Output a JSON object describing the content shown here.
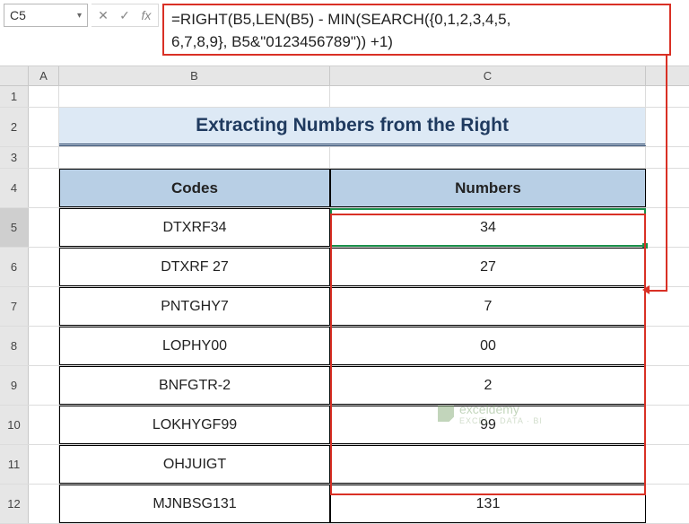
{
  "nameBox": {
    "value": "C5"
  },
  "formulaBar": {
    "line1": "=RIGHT(B5,LEN(B5) - MIN(SEARCH({0,1,2,3,4,5,",
    "line2": "6,7,8,9}, B5&\"0123456789\")) +1)"
  },
  "columns": {
    "A": "A",
    "B": "B",
    "C": "C"
  },
  "rowLabels": [
    "1",
    "2",
    "3",
    "4",
    "5",
    "6",
    "7",
    "8",
    "9",
    "10",
    "11",
    "12"
  ],
  "title": "Extracting Numbers from the Right",
  "headers": {
    "codes": "Codes",
    "numbers": "Numbers"
  },
  "table": [
    {
      "code": "DTXRF34",
      "num": "34"
    },
    {
      "code": "DTXRF 27",
      "num": "27"
    },
    {
      "code": "PNTGHY7",
      "num": "7"
    },
    {
      "code": "LOPHY00",
      "num": "00"
    },
    {
      "code": "BNFGTR-2",
      "num": "2"
    },
    {
      "code": "LOKHYGF99",
      "num": "99"
    },
    {
      "code": "OHJUIGT",
      "num": ""
    },
    {
      "code": "MJNBSG131",
      "num": "131"
    }
  ],
  "watermark": {
    "brand": "exceldemy",
    "tag": "EXCEL · DATA · BI"
  },
  "activeCell": "C5"
}
